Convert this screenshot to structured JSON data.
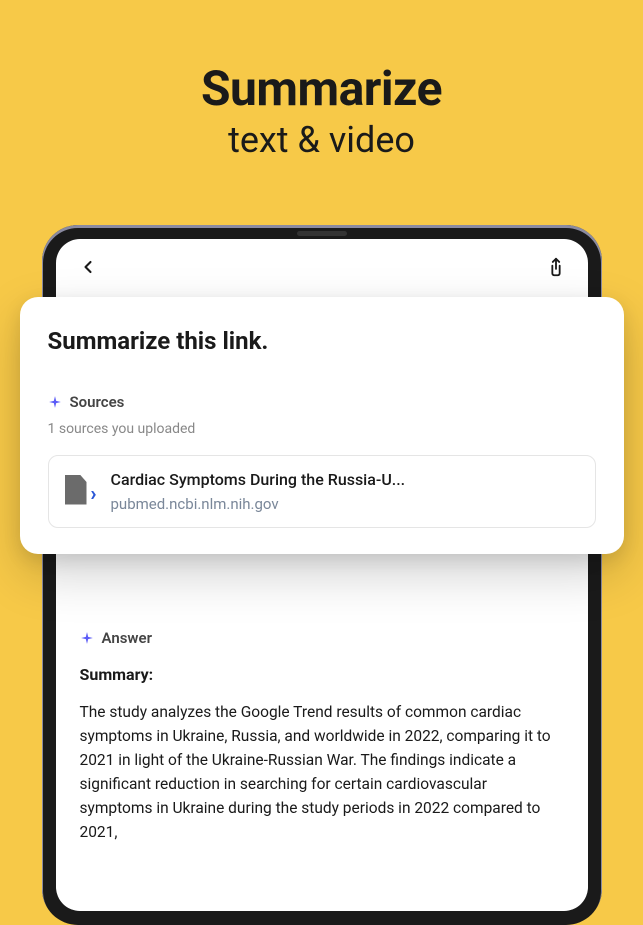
{
  "hero": {
    "title": "Summarize",
    "subtitle": "text & video"
  },
  "topbar": {
    "back_name": "back",
    "share_name": "share"
  },
  "card": {
    "title": "Summarize this link.",
    "sources_label": "Sources",
    "sources_meta": "1 sources you uploaded",
    "source": {
      "title": "Cardiac Symptoms During the Russia-U...",
      "domain": "pubmed.ncbi.nlm.nih.gov"
    }
  },
  "answer": {
    "label": "Answer",
    "summary_heading": "Summary:",
    "summary_body": "The study analyzes the Google Trend results of common cardiac symptoms in Ukraine, Russia, and worldwide in 2022, comparing it to 2021 in light of the Ukraine-Russian War. The findings indicate a significant reduction in searching for certain cardiovascular symptoms in Ukraine during the study periods in 2022 compared to 2021,"
  },
  "colors": {
    "accent": "#5b5bf7",
    "bg": "#f7c948"
  }
}
